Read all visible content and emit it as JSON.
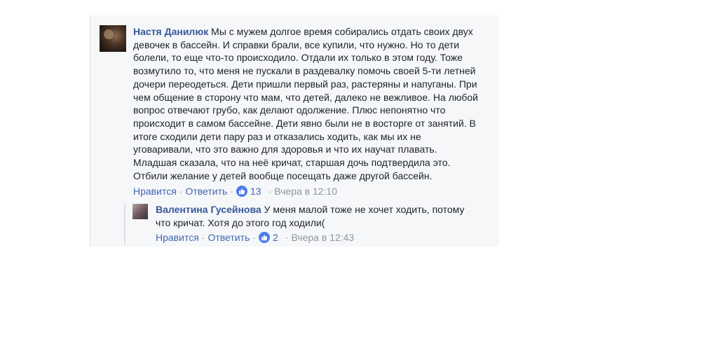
{
  "main_comment": {
    "author": "Настя Данилюк",
    "text_lines": [
      "Мы с мужем долгое время собирались отдать своих двух",
      "девочек в бассейн. И справки брали, все купили, что нужно. Но то дети",
      "болели, то еще что-то происходило. Отдали их только в этом году. Тоже",
      "возмутило то, что меня не пускали в раздевалку помочь своей 5-ти летней",
      "дочери переодеться. Дети пришли первый раз, растеряны и напуганы. При",
      "чем общение в сторону что мам, что детей, далеко не вежливое. На любой",
      "вопрос отвечают грубо, как делают одолжение. Плюс непонятно что",
      "происходит в самом бассейне. Дети явно были не в восторге от занятий. В",
      "итоге сходили дети пару раз и отказались ходить, как мы их не",
      "уговаривали, что это важно для здоровья и что их научат плавать.",
      "Младшая сказала, что на неё кричат, старшая дочь подтвердила это.",
      "Отбили желание у детей вообще посещать даже другой бассейн."
    ],
    "like_label": "Нравится",
    "reply_label": "Ответить",
    "like_count": "13",
    "timestamp": "Вчера в 12:10",
    "like_icon": "thumbs-up-icon"
  },
  "reply_comment": {
    "author": "Валентина Гусейнова",
    "text_lines": [
      "У меня малой тоже не хочет ходить, потому",
      "что кричат. Хотя до этого год ходили("
    ],
    "like_label": "Нравится",
    "reply_label": "Ответить",
    "like_count": "2",
    "timestamp": "Вчера в 12:43",
    "like_icon": "thumbs-up-icon"
  },
  "colors": {
    "author": "#365899",
    "link": "#4267b2",
    "text": "#1d2129",
    "meta": "#90949c",
    "panel_bg": "#f6f7f9",
    "like_badge": "#4a7cea"
  }
}
